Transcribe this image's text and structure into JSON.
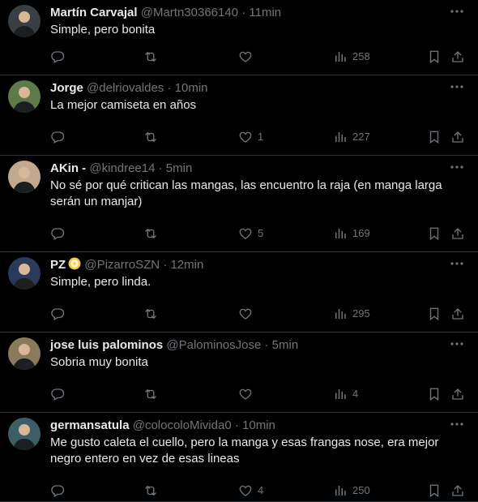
{
  "replies": [
    {
      "name": "Martín Carvajal",
      "handle": "@Martn30366140",
      "time": "11min",
      "text": "Simple, pero bonita",
      "likes": "",
      "views": "258",
      "avatar_color": "#3a3f44"
    },
    {
      "name": "Jorge",
      "handle": "@delriovaldes",
      "time": "10min",
      "text": "La mejor camiseta en años",
      "likes": "1",
      "views": "227",
      "avatar_color": "#5d7a48"
    },
    {
      "name": "AKin -",
      "handle": "@kindree14",
      "time": "5min",
      "text": "No sé por qué critican las mangas, las encuentro la raja (en manga larga serán un manjar)",
      "likes": "5",
      "views": "169",
      "avatar_color": "#c4a88e"
    },
    {
      "name": "PZ",
      "handle": "@PizarroSZN",
      "time": "12min",
      "text": "Simple, pero linda.",
      "likes": "",
      "views": "295",
      "avatar_color": "#2c3a5a",
      "badge": "disc-icon"
    },
    {
      "name": "jose luis palominos",
      "handle": "@PalominosJose",
      "time": "5min",
      "text": "Sobria muy bonita",
      "likes": "",
      "views": "4",
      "avatar_color": "#8a7a5c"
    },
    {
      "name": "germansatula",
      "handle": "@colocoloMivida0",
      "time": "10min",
      "text": "Me gusto caleta el cuello, pero la manga y esas frangas nose, era mejor negro entero en vez de esas lineas",
      "likes": "4",
      "views": "250",
      "avatar_color": "#3d5d68"
    }
  ],
  "separator": "·",
  "colors": {
    "background": "#000000",
    "text": "#e7e9ea",
    "muted": "#71767b",
    "border": "#2f3336"
  }
}
